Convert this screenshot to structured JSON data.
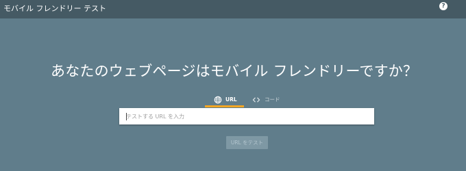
{
  "header": {
    "title": "モバイル フレンドリー テスト",
    "help_icon": "help-circle-icon",
    "help_glyph": "?"
  },
  "main": {
    "headline": "あなたのウェブページはモバイル フレンドリーですか？",
    "tabs": [
      {
        "label": "URL",
        "icon": "globe-icon",
        "selected": true
      },
      {
        "label": "コード",
        "icon": "code-icon",
        "selected": false
      }
    ],
    "url_input": {
      "value": "",
      "placeholder": "テストする URL を入力"
    },
    "submit_button": {
      "label": "URL をテスト",
      "enabled": false
    }
  },
  "colors": {
    "header_bg": "#455a64",
    "page_bg": "#607d8b",
    "tab_indicator": "#f5a623",
    "button_disabled_bg": "#7e98a4"
  }
}
